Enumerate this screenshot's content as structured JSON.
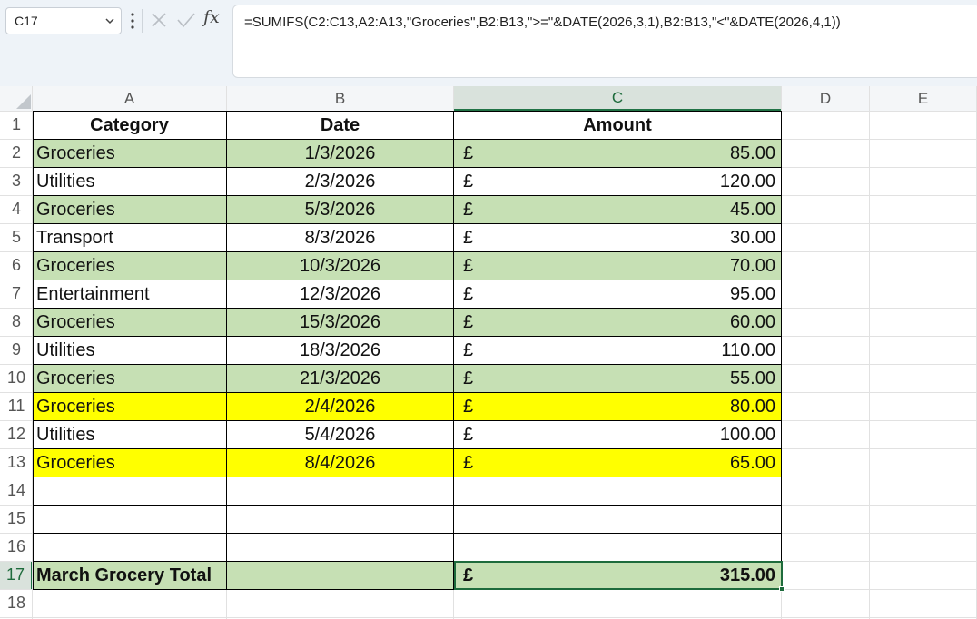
{
  "name_box": {
    "value": "C17"
  },
  "formula_bar": {
    "fx_label": "fx",
    "formula": "=SUMIFS(C2:C13,A2:A13,\"Groceries\",B2:B13,\">=\"&DATE(2026,3,1),B2:B13,\"<\"&DATE(2026,4,1))"
  },
  "icons": {
    "namebox_dropdown": "chevron-down-icon",
    "more_options": "vertical-ellipsis-icon",
    "cancel": "x-icon",
    "enter": "checkmark-icon",
    "insert_function": "fx-icon",
    "select_all": "triangle-corner-icon"
  },
  "colors": {
    "green_fill": "#c6e0b4",
    "yellow_fill": "#ffff00",
    "selection_accent": "#217346"
  },
  "sheet": {
    "columns": [
      "A",
      "B",
      "C",
      "D",
      "E"
    ],
    "selected_column": "C",
    "rows": [
      "1",
      "2",
      "3",
      "4",
      "5",
      "6",
      "7",
      "8",
      "9",
      "10",
      "11",
      "12",
      "13",
      "14",
      "15",
      "16",
      "17",
      "18"
    ],
    "selected_row": "17",
    "active_cell": "C17",
    "header": {
      "category": "Category",
      "date": "Date",
      "amount": "Amount"
    },
    "data": [
      {
        "category": "Groceries",
        "date": "1/3/2026",
        "currency": "£",
        "amount": "85.00",
        "fill": "green"
      },
      {
        "category": "Utilities",
        "date": "2/3/2026",
        "currency": "£",
        "amount": "120.00",
        "fill": "none"
      },
      {
        "category": "Groceries",
        "date": "5/3/2026",
        "currency": "£",
        "amount": "45.00",
        "fill": "green"
      },
      {
        "category": "Transport",
        "date": "8/3/2026",
        "currency": "£",
        "amount": "30.00",
        "fill": "none"
      },
      {
        "category": "Groceries",
        "date": "10/3/2026",
        "currency": "£",
        "amount": "70.00",
        "fill": "green"
      },
      {
        "category": "Entertainment",
        "date": "12/3/2026",
        "currency": "£",
        "amount": "95.00",
        "fill": "none"
      },
      {
        "category": "Groceries",
        "date": "15/3/2026",
        "currency": "£",
        "amount": "60.00",
        "fill": "green"
      },
      {
        "category": "Utilities",
        "date": "18/3/2026",
        "currency": "£",
        "amount": "110.00",
        "fill": "none"
      },
      {
        "category": "Groceries",
        "date": "21/3/2026",
        "currency": "£",
        "amount": "55.00",
        "fill": "green"
      },
      {
        "category": "Groceries",
        "date": "2/4/2026",
        "currency": "£",
        "amount": "80.00",
        "fill": "yellow"
      },
      {
        "category": "Utilities",
        "date": "5/4/2026",
        "currency": "£",
        "amount": "100.00",
        "fill": "none"
      },
      {
        "category": "Groceries",
        "date": "8/4/2026",
        "currency": "£",
        "amount": "65.00",
        "fill": "yellow"
      }
    ],
    "total": {
      "label": "March Grocery Total",
      "currency": "£",
      "amount": "315.00",
      "fill": "green"
    }
  }
}
